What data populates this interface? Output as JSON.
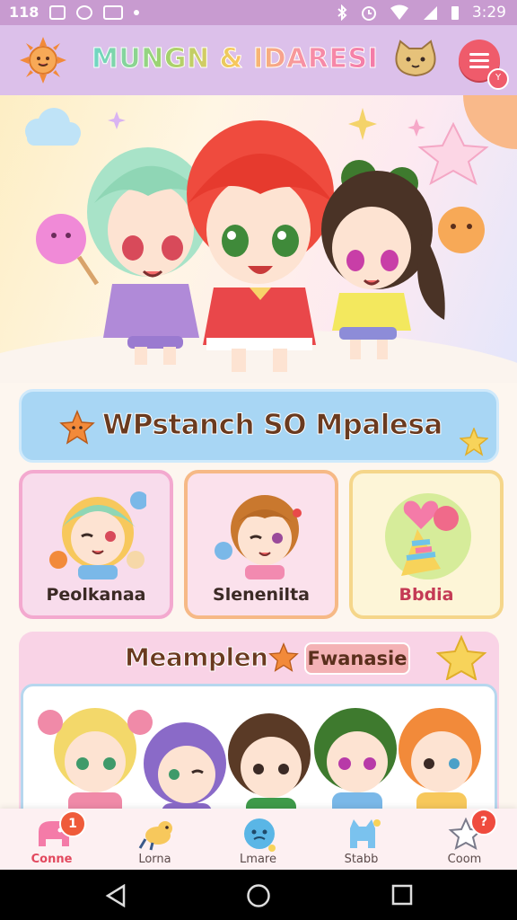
{
  "status_bar": {
    "time": "3:29",
    "left_text": "118"
  },
  "app_bar": {
    "title": "MUNGN & IDARESI",
    "badge": "Y"
  },
  "banner": {
    "title": "WPstanch SO Mpalesa"
  },
  "cards": [
    {
      "label": "Peolkanaa"
    },
    {
      "label": "Slenenilta"
    },
    {
      "label": "Bbdia"
    }
  ],
  "section2": {
    "title": "Meamplen",
    "tag": "Fwanasie"
  },
  "bottom_nav": {
    "items": [
      {
        "label": "Conne",
        "badge": "1",
        "icon": "elephant-icon"
      },
      {
        "label": "Lorna",
        "icon": "pony-icon"
      },
      {
        "label": "Lmare",
        "icon": "blue-face-icon"
      },
      {
        "label": "Stabb",
        "icon": "blue-cat-icon"
      },
      {
        "label": "Coom",
        "badge": "?",
        "icon": "star-person-icon"
      }
    ]
  },
  "colors": {
    "accent": "#ef5b6b",
    "appbar": "#dcc0ea",
    "banner": "#a8d6f4",
    "nav_active": "#ef5b3a"
  }
}
